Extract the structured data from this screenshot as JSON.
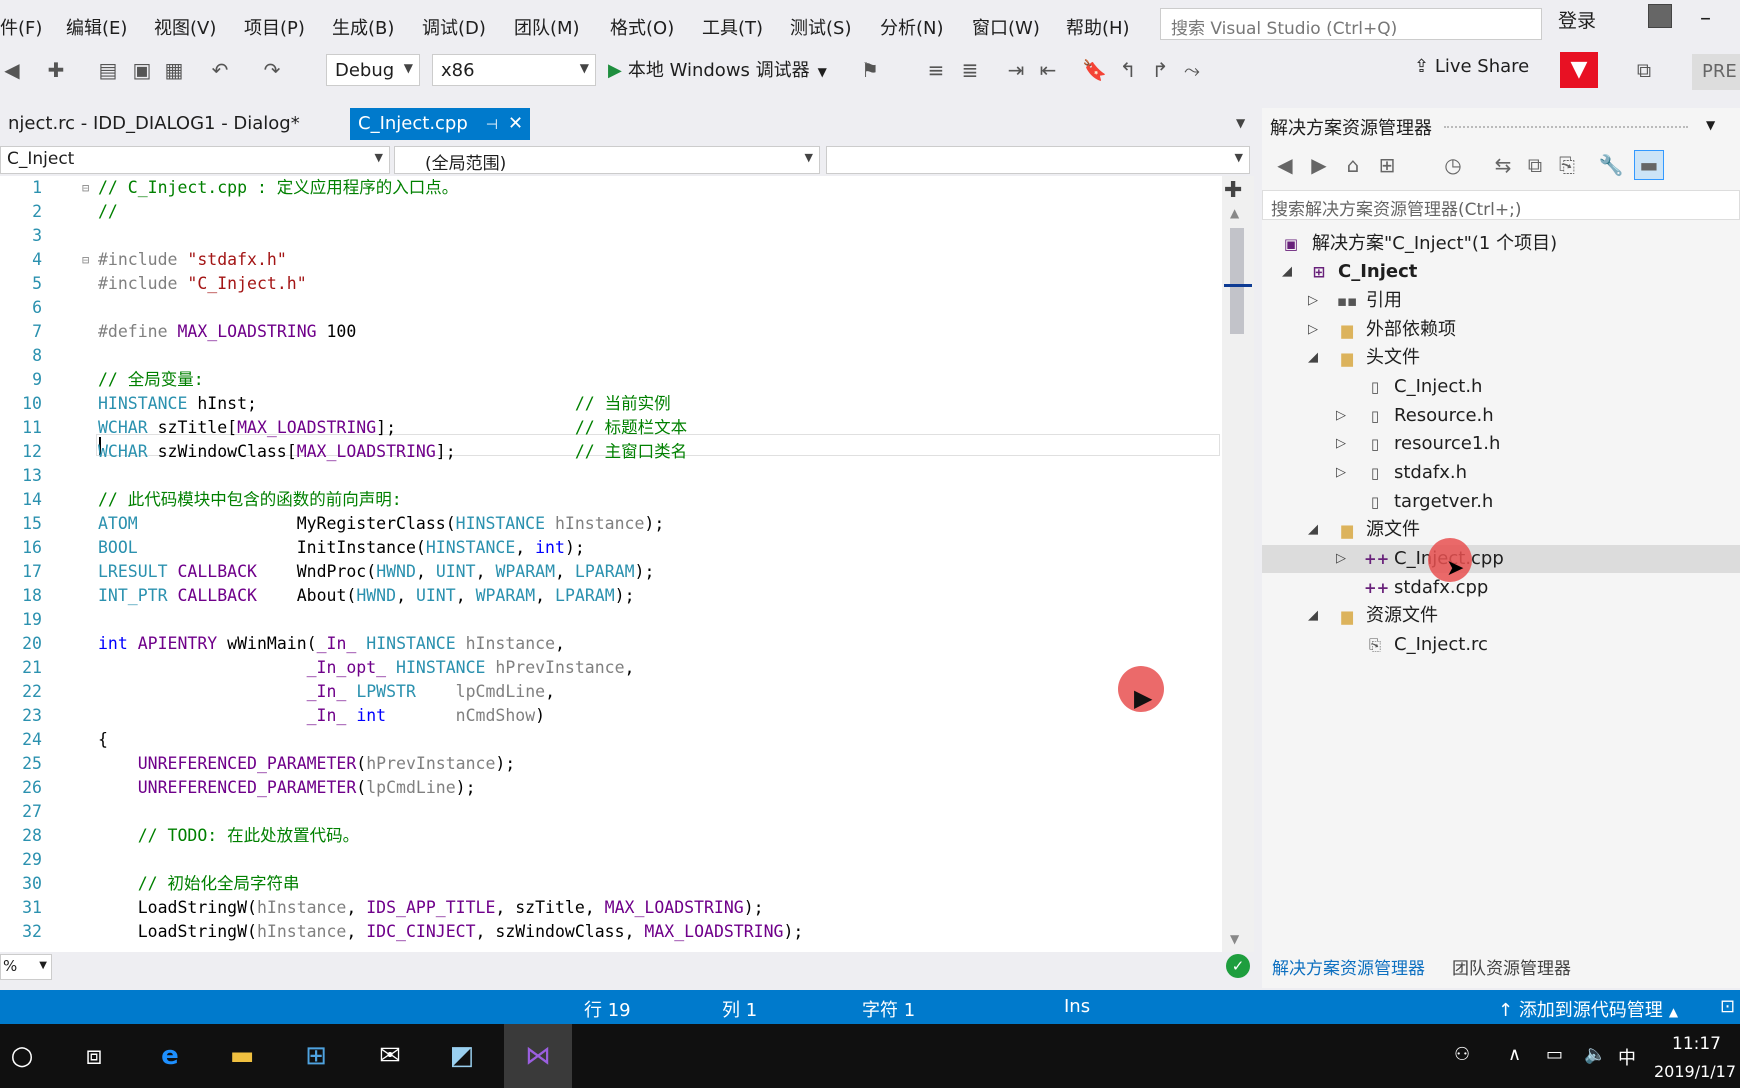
{
  "menu": {
    "items": [
      "件(F)",
      "编辑(E)",
      "视图(V)",
      "项目(P)",
      "生成(B)",
      "调试(D)",
      "团队(M)",
      "格式(O)",
      "工具(T)",
      "测试(S)",
      "分析(N)",
      "窗口(W)",
      "帮助(H)"
    ],
    "search_placeholder": "搜索 Visual Studio (Ctrl+Q)",
    "login": "登录",
    "minimize": "–"
  },
  "toolbar": {
    "config": "Debug",
    "platform": "x86",
    "run_label": "本地 Windows 调试器",
    "live_share": "Live Share",
    "preview_label": "PRE"
  },
  "tabs": {
    "rc_label": "nject.rc - IDD_DIALOG1 - Dialog*",
    "cpp_label": "C_Inject.cpp"
  },
  "nav": {
    "project": "C_Inject",
    "scope": "(全局范围)",
    "member": ""
  },
  "editor": {
    "line_numbers": [
      "1",
      "2",
      "3",
      "4",
      "5",
      "6",
      "7",
      "8",
      "9",
      "10",
      "11",
      "12",
      "13",
      "14",
      "15",
      "16",
      "17",
      "18",
      "19",
      "20",
      "21",
      "22",
      "23",
      "24",
      "25",
      "26",
      "27",
      "28",
      "29",
      "30",
      "31",
      "32"
    ],
    "zoom": "%"
  },
  "solution": {
    "title": "解决方案资源管理器",
    "search_placeholder": "搜索解决方案资源管理器(Ctrl+;)",
    "root": "解决方案\"C_Inject\"(1 个项目)",
    "project": "C_Inject",
    "references": "引用",
    "external_deps": "外部依赖项",
    "headers_folder": "头文件",
    "headers": [
      "C_Inject.h",
      "Resource.h",
      "resource1.h",
      "stdafx.h",
      "targetver.h"
    ],
    "sources_folder": "源文件",
    "sources": [
      "C_Inject.cpp",
      "stdafx.cpp"
    ],
    "resources_folder": "资源文件",
    "resources": [
      "C_Inject.rc"
    ],
    "bottom_tab_solution": "解决方案资源管理器",
    "bottom_tab_team": "团队资源管理器"
  },
  "status": {
    "line": "行 19",
    "col": "列 1",
    "char": "字符 1",
    "mode": "Ins",
    "source_control": "添加到源代码管理"
  },
  "taskbar": {
    "ime": "中",
    "time": "11:17",
    "date": "2019/1/17"
  },
  "colors": {
    "accent": "#007acc",
    "status_bar": "#007acc",
    "feedback": "#e81123"
  }
}
